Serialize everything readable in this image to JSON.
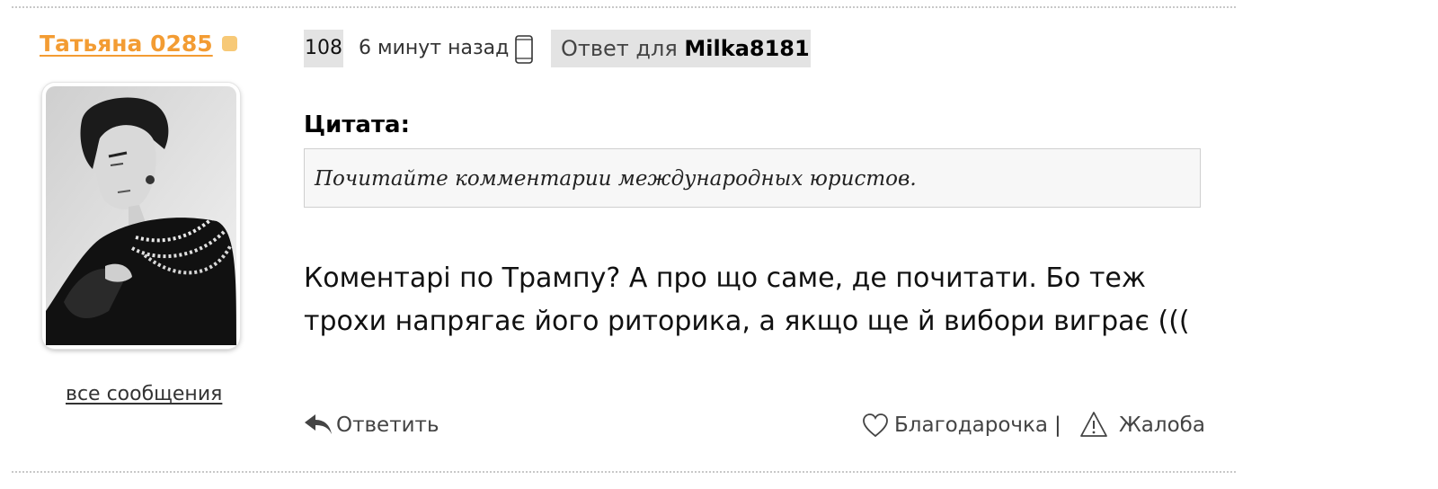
{
  "post": {
    "author": "Татьяна 0285",
    "all_posts_link": "все сообщения",
    "post_number": "108",
    "time_ago": "6 минут назад",
    "reply_to_label": "Ответ для",
    "reply_to_user": "Milka8181",
    "quote_title": "Цитата:",
    "quote_text": "Почитайте комментарии международных юристов.",
    "message": "Коментарі по Трампу? А про що саме, де почитати. Бо теж трохи напрягає його риторика, а якщо ще й вибори виграє (((",
    "actions": {
      "reply": "Ответить",
      "thanks": "Благодарочка",
      "separator": "|",
      "complaint": "Жалоба"
    }
  },
  "icons": {
    "device": "mobile-phone-icon",
    "reply": "reply-arrow-icon",
    "thanks": "heart-icon",
    "complaint": "warning-triangle-icon"
  },
  "colors": {
    "author_link": "#f39c33",
    "online_dot": "#f7c977",
    "badge_bg": "#e3e3e3",
    "quote_bg": "#f7f7f7"
  }
}
